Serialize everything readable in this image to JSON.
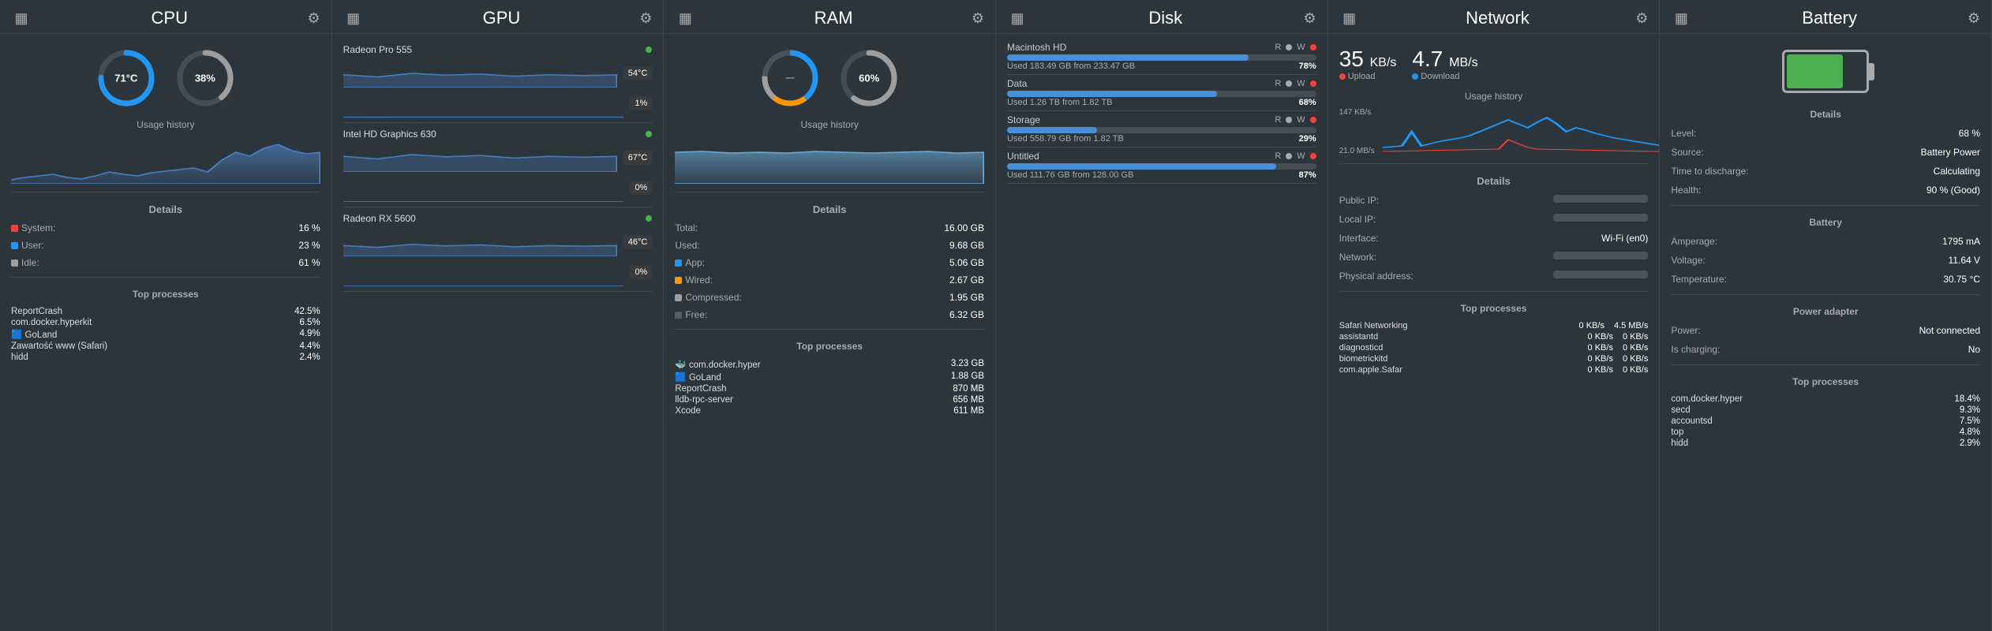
{
  "cpu": {
    "title": "CPU",
    "temp": "71°C",
    "usage": "38%",
    "usage_pct": 38,
    "usage_history_label": "Usage history",
    "details_label": "Details",
    "system": "16 %",
    "user": "23 %",
    "idle": "61 %",
    "top_processes_label": "Top processes",
    "processes": [
      {
        "name": "ReportCrash",
        "val": "42.5%",
        "icon": ""
      },
      {
        "name": "com.docker.hyperkit",
        "val": "6.5%",
        "icon": ""
      },
      {
        "name": "GoLand",
        "val": "4.9%",
        "icon": "goland"
      },
      {
        "name": "Zawartość www (Safari)",
        "val": "4.4%",
        "icon": ""
      },
      {
        "name": "hidd",
        "val": "2.4%",
        "icon": ""
      }
    ]
  },
  "gpu": {
    "title": "GPU",
    "cards": [
      {
        "name": "Radeon Pro 555",
        "active": true,
        "bars": [
          {
            "temp": "54°C",
            "pct": 45
          },
          {
            "temp": "1%",
            "pct": 1
          }
        ]
      },
      {
        "name": "Intel HD Graphics 630",
        "active": true,
        "bars": [
          {
            "temp": "67°C",
            "pct": 55
          },
          {
            "temp": "0%",
            "pct": 0
          }
        ]
      },
      {
        "name": "Radeon RX 5600",
        "active": true,
        "bars": [
          {
            "temp": "46°C",
            "pct": 38
          },
          {
            "temp": "0%",
            "pct": 0
          }
        ]
      }
    ]
  },
  "ram": {
    "title": "RAM",
    "usage_pct": 60,
    "usage_label": "60%",
    "usage_history_label": "Usage history",
    "details_label": "Details",
    "total": "16.00 GB",
    "used": "9.68 GB",
    "app": "5.06 GB",
    "wired": "2.67 GB",
    "compressed": "1.95 GB",
    "free": "6.32 GB",
    "top_processes_label": "Top processes",
    "processes": [
      {
        "name": "com.docker.hyper",
        "val": "3.23 GB",
        "icon": "docker"
      },
      {
        "name": "GoLand",
        "val": "1.88 GB",
        "icon": "goland"
      },
      {
        "name": "ReportCrash",
        "val": "870 MB",
        "icon": ""
      },
      {
        "name": "lldb-rpc-server",
        "val": "656 MB",
        "icon": ""
      },
      {
        "name": "Xcode",
        "val": "611 MB",
        "icon": ""
      }
    ]
  },
  "disk": {
    "title": "Disk",
    "volumes": [
      {
        "name": "Macintosh HD",
        "used_text": "Used 183.49 GB from 233.47 GB",
        "pct": 78,
        "pct_label": "78%",
        "color": "#4a90d9"
      },
      {
        "name": "Data",
        "used_text": "Used 1.26 TB from 1.82 TB",
        "pct": 68,
        "pct_label": "68%",
        "color": "#4a90d9"
      },
      {
        "name": "Storage",
        "used_text": "Used 558.79 GB from 1.82 TB",
        "pct": 29,
        "pct_label": "29%",
        "color": "#4a90d9"
      },
      {
        "name": "Untitled",
        "used_text": "Used 111.76 GB from 128.00 GB",
        "pct": 87,
        "pct_label": "87%",
        "color": "#4a90d9"
      }
    ]
  },
  "network": {
    "title": "Network",
    "upload_val": "35",
    "upload_unit": "KB/s",
    "upload_label": "Upload",
    "download_val": "4.7",
    "download_unit": "MB/s",
    "download_label": "Download",
    "usage_history_label": "Usage history",
    "y_max": "147 KB/s",
    "y_min": "21.0 MB/s",
    "details_label": "Details",
    "public_ip_label": "Public IP:",
    "local_ip_label": "Local IP:",
    "interface_label": "Interface:",
    "interface_val": "Wi-Fi (en0)",
    "network_label": "Network:",
    "physical_label": "Physical address:",
    "top_processes_label": "Top processes",
    "processes": [
      {
        "name": "Safari Networking",
        "upload": "0 KB/s",
        "download": "4.5 MB/s"
      },
      {
        "name": "assistantd",
        "upload": "0 KB/s",
        "download": "0 KB/s"
      },
      {
        "name": "diagnosticd",
        "upload": "0 KB/s",
        "download": "0 KB/s"
      },
      {
        "name": "biometrickitd",
        "upload": "0 KB/s",
        "download": "0 KB/s"
      },
      {
        "name": "com.apple.Safar",
        "upload": "0 KB/s",
        "download": "0 KB/s"
      }
    ]
  },
  "battery": {
    "title": "Battery",
    "level_pct": 68,
    "level_label": "68 %",
    "fill_width_pct": 68,
    "details_label": "Details",
    "level_key": "Level:",
    "source_key": "Source:",
    "source_val": "Battery Power",
    "discharge_key": "Time to discharge:",
    "discharge_val": "Calculating",
    "health_key": "Health:",
    "health_val": "90 % (Good)",
    "battery_section": "Battery",
    "amperage_key": "Amperage:",
    "amperage_val": "1795 mA",
    "voltage_key": "Voltage:",
    "voltage_val": "11.64 V",
    "temp_key": "Temperature:",
    "temp_val": "30.75 °C",
    "adapter_section": "Power adapter",
    "power_key": "Power:",
    "power_val": "Not connected",
    "charging_key": "Is charging:",
    "charging_val": "No",
    "top_processes_label": "Top processes",
    "processes": [
      {
        "name": "com.docker.hyper",
        "val": "18.4%"
      },
      {
        "name": "secd",
        "val": "9.3%"
      },
      {
        "name": "accountsd",
        "val": "7.5%"
      },
      {
        "name": "top",
        "val": "4.8%"
      },
      {
        "name": "hidd",
        "val": "2.9%"
      }
    ]
  },
  "icons": {
    "bar_chart": "▦",
    "gear": "⚙"
  }
}
